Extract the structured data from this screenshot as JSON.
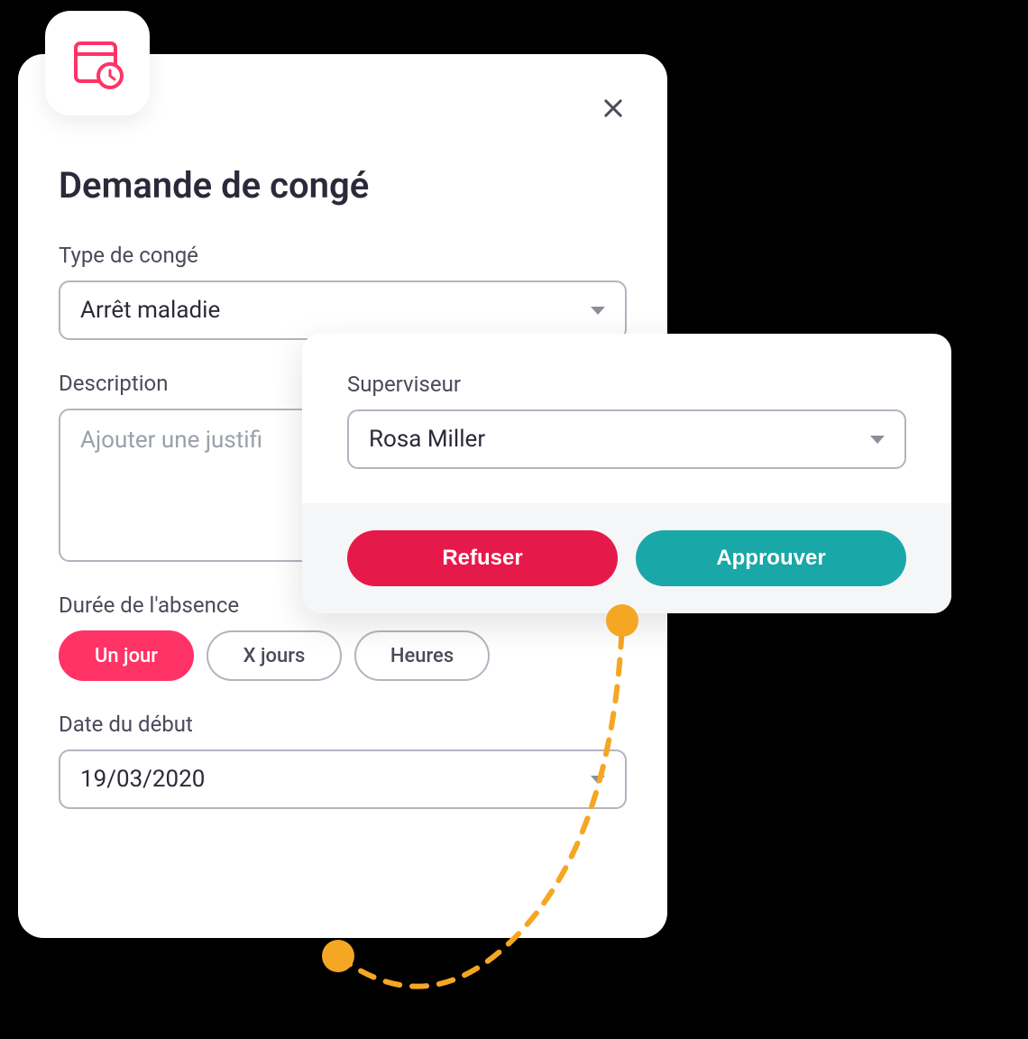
{
  "modal": {
    "title": "Demande de congé",
    "fields": {
      "leave_type": {
        "label": "Type de congé",
        "value": "Arrêt maladie"
      },
      "description": {
        "label": "Description",
        "placeholder": "Ajouter une justifi"
      },
      "duration": {
        "label": "Durée de l'absence",
        "options": {
          "one_day": "Un jour",
          "x_days": "X jours",
          "hours": "Heures"
        },
        "selected": "one_day"
      },
      "start_date": {
        "label": "Date du début",
        "value": "19/03/2020"
      }
    }
  },
  "supervisor_panel": {
    "label": "Superviseur",
    "value": "Rosa Miller",
    "actions": {
      "refuse": "Refuser",
      "approve": "Approuver"
    }
  },
  "colors": {
    "primary_red": "#ff3366",
    "danger_red": "#e6194b",
    "teal": "#1aa7a7",
    "orange": "#f5a623",
    "text_dark": "#2a2a3a",
    "text_muted": "#4a4a5a",
    "border": "#b0b5c0"
  }
}
